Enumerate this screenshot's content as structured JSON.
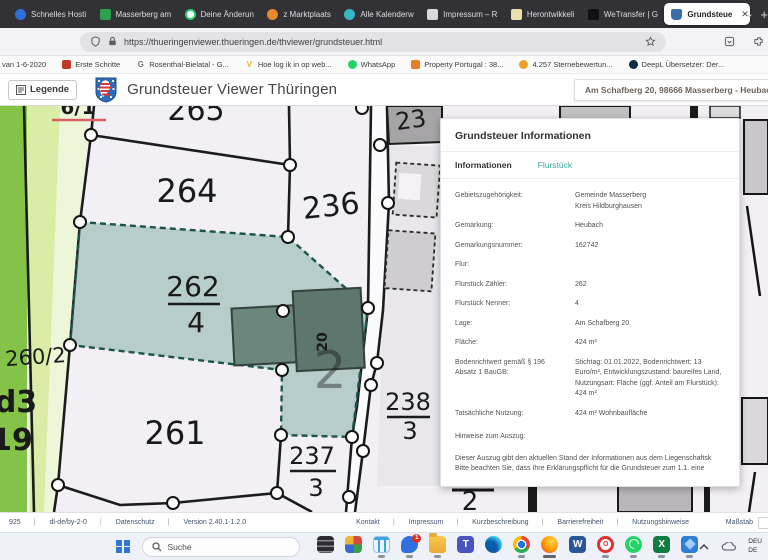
{
  "browser": {
    "tabs": [
      {
        "label": "Schnelles Hosti",
        "icon": "blue-circle"
      },
      {
        "label": "Masserberg am",
        "icon": "green-webcam"
      },
      {
        "label": "Deine Änderun",
        "icon": "green-ring"
      },
      {
        "label": "z Marktplaats",
        "icon": "orange-circle"
      },
      {
        "label": "Alle Kalenderw",
        "icon": "teal-circle"
      },
      {
        "label": "Impressum – R",
        "icon": "gray-doc"
      },
      {
        "label": "Herontwikkeli",
        "icon": "cream-square"
      },
      {
        "label": "WeTransfer | G",
        "icon": "black-flag"
      },
      {
        "label": "Grundsteue",
        "icon": "thuringia-shield",
        "active": true
      }
    ],
    "url": "https://thueringenviewer.thueringen.de/thviewer/grundsteuer.html",
    "bookmarks": [
      {
        "label": "van 1-6-2020",
        "fav": ""
      },
      {
        "label": "Erste Schritte",
        "fav": ""
      },
      {
        "label": "Rosenthal-Bielatal - G...",
        "fav": "G"
      },
      {
        "label": "Hoe log ik in op web...",
        "fav": "V"
      },
      {
        "label": "WhatsApp",
        "fav": ""
      },
      {
        "label": "Property Portugal : 38...",
        "fav": ""
      },
      {
        "label": "4.257 Sternebewertun...",
        "fav": ""
      },
      {
        "label": "DeepL Übersetzer: Der...",
        "fav": ""
      }
    ]
  },
  "header": {
    "legende_label": "Legende",
    "title": "Grundsteuer Viewer Thüringen",
    "address": "Am Schafberg 20, 98666 Masserberg - Heubac"
  },
  "map": {
    "selected_parcel": "262/4",
    "labels": {
      "p6_1": "6/1",
      "p265": "265",
      "p264": "264",
      "p236": "236",
      "p23": "23",
      "p262_num": "262",
      "p262_den": "4",
      "p260_2": "260/2",
      "p261": "261",
      "p237_num": "237",
      "p237_den": "3",
      "p238_num": "238",
      "p238_den": "3",
      "building_20": "20",
      "big_2": "2",
      "wald_a": "d3",
      "wald_b": "19",
      "below_2": "2"
    },
    "colors": {
      "selection_fill": "#57958a",
      "selection_stroke": "#1c544b",
      "green_strip": "#84c248",
      "light_green_strip": "#d9eda6"
    }
  },
  "panel": {
    "title": "Grundsteuer Informationen",
    "tabs": [
      {
        "label": "Informationen",
        "active": true
      },
      {
        "label": "Flurstück",
        "active": false
      }
    ],
    "fields": [
      {
        "label": "Gebietszugehörigkeit:",
        "value": "Gemeinde Masserberg",
        "value2": "Kreis Hildburghausen"
      },
      {
        "label": "Gemarkung:",
        "value": "Heubach"
      },
      {
        "label": "Gemarkungsnummer:",
        "value": "162742"
      },
      {
        "label": "Flur:",
        "value": ""
      },
      {
        "label": "Flurstück Zähler:",
        "value": "262"
      },
      {
        "label": "Flurstück Nenner:",
        "value": "4"
      },
      {
        "label": "Lage:",
        "value": "Am Schafberg 20"
      },
      {
        "label": "Fläche:",
        "value": "424 m²"
      },
      {
        "label": "Bodenrichtwert gemäß § 196 Absatz 1 BauGB:",
        "value": "Stichtag: 01.01.2022, Bodenrichtwert: 13 Euro/m², Entwicklungszustand: baureifes Land, Nutzungsart: Fläche (ggf. Anteil am Flurstück): 424 m²"
      },
      {
        "label": "Tatsächliche Nutzung:",
        "value": "424 m² Wohnbaufläche"
      }
    ],
    "hinweise_heading": "Hinweise zum Auszug:",
    "hinweise_line1": "Dieser Auszug gibt den aktuellen Stand der Informationen aus dem Liegenschaftsk",
    "hinweise_line2": "Bitte beachten Sie, dass Ihre Erklärungspflicht für die Grundsteuer zum 1.1. eine"
  },
  "footer": {
    "left": [
      "925",
      "dl-de/by-2-0",
      "Datenschutz",
      "Version 2.40.1-1.2.0"
    ],
    "links": [
      "Kontakt",
      "Impressum",
      "Kurzbeschreibung",
      "Barrierefreiheit",
      "Nutzungshinweise"
    ],
    "right": "Maßstab"
  },
  "taskbar": {
    "search_placeholder": "Suche",
    "maps_badge": "1",
    "teams_glyph": "T",
    "word_glyph": "W",
    "opera_glyph": "O",
    "excel_glyph": "X",
    "lang_line1": "DEU",
    "lang_line2": "DE"
  }
}
